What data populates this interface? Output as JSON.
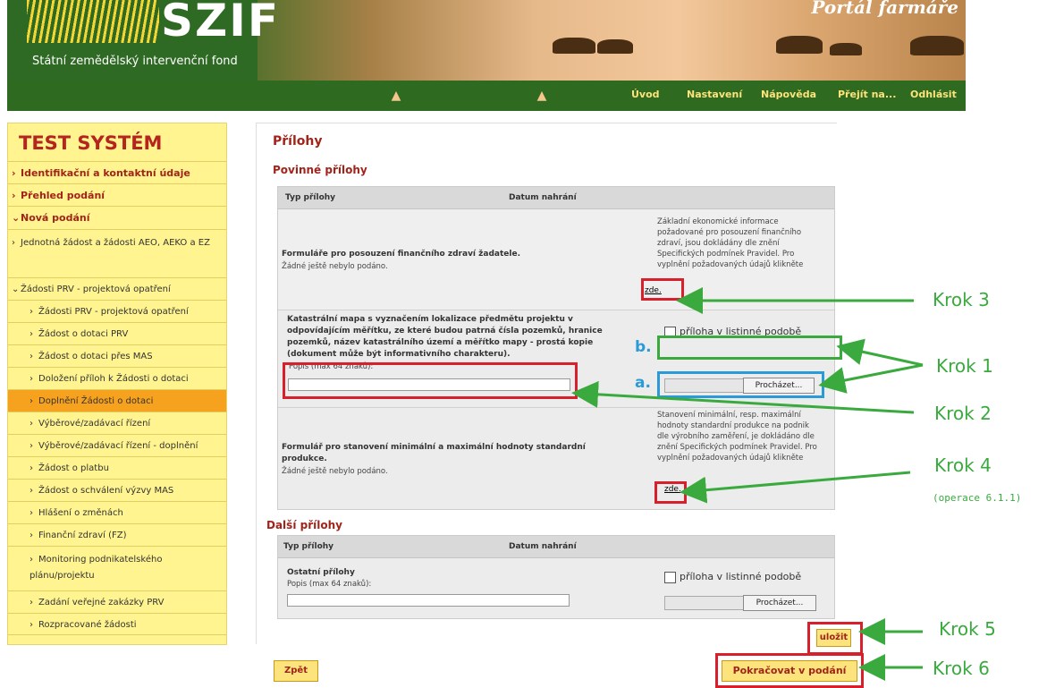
{
  "header": {
    "logo": "SZIF",
    "org_name": "Státní zemědělský intervenční fond",
    "portal_title": "Portál farmáře"
  },
  "nav": {
    "items": [
      "Úvod",
      "Nastavení",
      "Nápověda",
      "Přejít na...",
      "Odhlásit"
    ]
  },
  "sidebar": {
    "title": "TEST SYSTÉM",
    "items": [
      {
        "label": "Identifikační a kontaktní údaje"
      },
      {
        "label": "Přehled podání"
      },
      {
        "label": "Nová podání"
      },
      {
        "label": "Jednotná žádost a žádosti AEO, AEKO a EZ"
      },
      {
        "label": "Žádosti PRV - projektová opatření"
      },
      {
        "label": "Žádosti PRV - projektová opatření"
      },
      {
        "label": "Žádost o dotaci PRV"
      },
      {
        "label": "Žádost o dotaci přes MAS"
      },
      {
        "label": "Doložení příloh k Žádosti o dotaci"
      },
      {
        "label": "Doplnění Žádosti o dotaci"
      },
      {
        "label": "Výběrové/zadávací řízení"
      },
      {
        "label": "Výběrové/zadávací řízení - doplnění"
      },
      {
        "label": "Žádost o platbu"
      },
      {
        "label": "Žádost o schválení výzvy MAS"
      },
      {
        "label": "Hlášení o změnách"
      },
      {
        "label": "Finanční zdraví (FZ)"
      },
      {
        "label": "Monitoring podnikatelského plánu/projektu"
      },
      {
        "label": "Zadání veřejné zakázky PRV"
      },
      {
        "label": "Rozpracované žádosti"
      }
    ]
  },
  "main": {
    "title": "Přílohy",
    "required_heading": "Povinné přílohy",
    "other_heading": "Další přílohy",
    "col_type": "Typ přílohy",
    "col_date": "Datum nahrání",
    "rows": {
      "r1": {
        "title": "Formuláře pro posouzení finančního zdraví žadatele.",
        "status": "Žádné ještě nebylo podáno.",
        "info": "Základní ekonomické informace požadované pro posouzení finančního zdraví, jsou dokládány dle znění Specifických podmínek Pravidel. Pro vyplnění požadovaných údajů klikněte",
        "link": "zde."
      },
      "r2": {
        "title": "Katastrální mapa s vyznačením lokalizace předmětu projektu v odpovídajícím měřítku, ze které budou patrná čísla pozemků, hranice pozemků, název katastrálního území a měřítko mapy - prostá kopie (dokument může být informativního charakteru).",
        "desc_label": "Popis (max 64 znaků):",
        "checkbox_label": "příloha v listinné podobě",
        "browse": "Procházet...",
        "marker_b": "b.",
        "marker_a": "a."
      },
      "r3": {
        "title": "Formulář pro stanovení minimální a maximální hodnoty standardní produkce.",
        "status": "Žádné ještě nebylo podáno.",
        "info": "Stanovení minimální, resp. maximální hodnoty standardní produkce na podnik dle výrobního zaměření, je dokládáno dle znění Specifických podmínek Pravidel. Pro vyplnění požadovaných údajů klikněte",
        "link": "zde."
      },
      "r4": {
        "title": "Ostatní přílohy",
        "desc_label": "Popis (max 64 znaků):",
        "checkbox_label": "příloha v listinné podobě",
        "browse": "Procházet..."
      }
    },
    "save_button": "uložit",
    "back_button": "Zpět",
    "continue_button": "Pokračovat v podání"
  },
  "annotations": {
    "krok1": "Krok 1",
    "krok2": "Krok 2",
    "krok3": "Krok 3",
    "krok4": "Krok 4",
    "krok4_note": "(operace 6.1.1)",
    "krok5": "Krok 5",
    "krok6": "Krok 6"
  },
  "colors": {
    "brand_green": "#2e6a1f",
    "sidebar_yellow": "#fff48f",
    "active_orange": "#f7a21e",
    "title_red": "#a1241b",
    "annotation_green": "#3aaa3f",
    "annotation_red": "#d8202d",
    "annotation_blue": "#2a9bd8"
  }
}
